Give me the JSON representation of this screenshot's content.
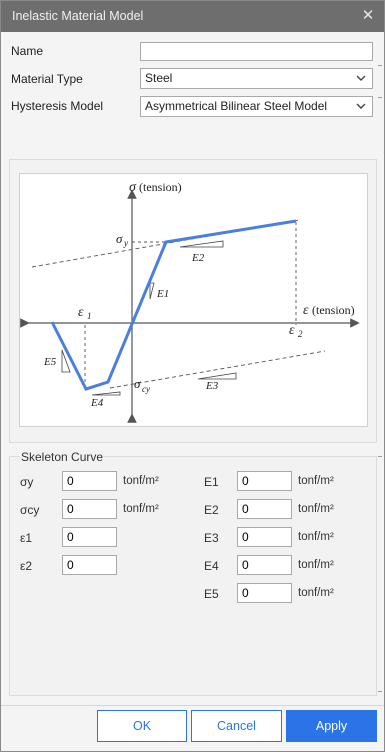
{
  "window": {
    "title": "Inelastic Material Model",
    "close_icon": "close-icon"
  },
  "form": {
    "name_label": "Name",
    "name_value": "",
    "material_type_label": "Material Type",
    "material_type_value": "Steel",
    "hysteresis_label": "Hysteresis Model",
    "hysteresis_value": "Asymmetrical Bilinear Steel Model"
  },
  "diagram": {
    "sigma": "σ",
    "tension_y": "(tension)",
    "epsilon": "ε",
    "tension_x": "(tension)",
    "sigma_y": "σ",
    "sigma_y_sub": "y",
    "sigma_cy": "σ",
    "sigma_cy_sub": "cy",
    "eps1": "ε",
    "eps1_sub": "1",
    "eps2": "ε",
    "eps2_sub": "2",
    "e1": "E1",
    "e2": "E2",
    "e3": "E3",
    "e4": "E4",
    "e5": "E5",
    "curve_color": "#4a7fe0"
  },
  "skeleton": {
    "title": "Skeleton Curve",
    "unit": "tonf/m²",
    "left": [
      {
        "label": "σy",
        "value": "0"
      },
      {
        "label": "σcy",
        "value": "0"
      },
      {
        "label": "ε1",
        "value": "0"
      },
      {
        "label": "ε2",
        "value": "0"
      }
    ],
    "right": [
      {
        "label": "E1",
        "value": "0"
      },
      {
        "label": "E2",
        "value": "0"
      },
      {
        "label": "E3",
        "value": "0"
      },
      {
        "label": "E4",
        "value": "0"
      },
      {
        "label": "E5",
        "value": "0"
      }
    ]
  },
  "buttons": {
    "ok": "OK",
    "cancel": "Cancel",
    "apply": "Apply"
  },
  "colors": {
    "accent": "#2a74e8",
    "titlebar": "#6e6e6e"
  }
}
